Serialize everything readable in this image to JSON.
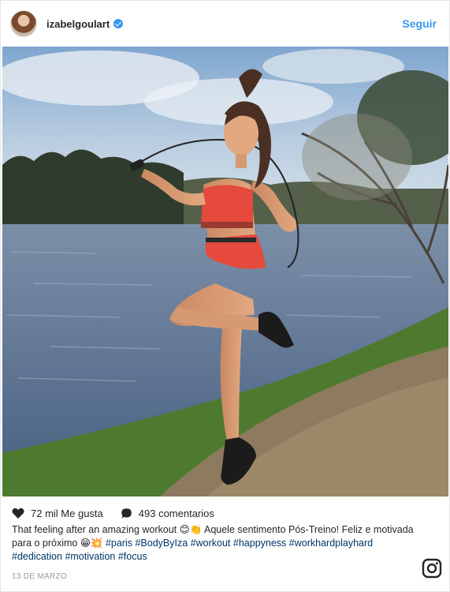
{
  "header": {
    "username": "izabelgoulart",
    "follow_label": "Seguir"
  },
  "post": {
    "likes": "72 mil Me gusta",
    "comments": "493 comentarios",
    "caption_text": "That feeling after an amazing workout 😊👏 Aquele sentimento Pós-Treino! Feliz e motivada para o próximo 😁💥",
    "hashtags": [
      "#paris",
      "#BodyByIza",
      "#workout",
      "#happyness",
      "#workhardplayhard",
      "#dedication",
      "#motivation",
      "#focus"
    ],
    "date": "13 DE MARZO"
  },
  "icons": {
    "verified": "verified-badge-icon",
    "like": "heart-icon",
    "comment": "comment-icon",
    "instagram": "instagram-logo-icon"
  },
  "colors": {
    "link": "#3897f0",
    "hashtag": "#003569",
    "text": "#262626",
    "muted": "#999999"
  }
}
